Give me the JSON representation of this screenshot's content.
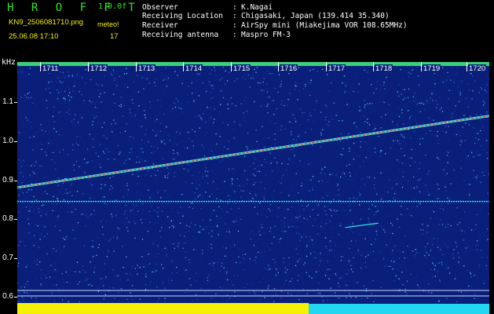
{
  "header": {
    "title": "H R O F F T",
    "version": "1.0.0f",
    "filename": "KN9_2506081710.png",
    "mode": "meteo!",
    "datetime": "25.06.08 17:10",
    "count": "17",
    "info": [
      {
        "label": "Observer",
        "value": "K.Nagai"
      },
      {
        "label": "Receiving Location",
        "value": "Chigasaki, Japan (139.414 35.340)"
      },
      {
        "label": "Receiver",
        "value": "AirSpy mini (Miakejima VOR 108.65MHz)"
      },
      {
        "label": "Receiving antenna",
        "value": "Maspro FM-3"
      }
    ],
    "colon": ":"
  },
  "axes": {
    "unit": "kHz",
    "y_ticks": [
      "1.1",
      "1.0",
      "0.9",
      "0.8",
      "0.7",
      "0.6"
    ],
    "x_ticks": [
      "1711",
      "1712",
      "1713",
      "1714",
      "1715",
      "1716",
      "1717",
      "1718",
      "1719",
      "1720"
    ]
  },
  "colors": {
    "background": "#0a1f7a",
    "signal_strong": "#ff2a2a",
    "signal_mid": "#2ee8e8",
    "bottom_bar_left": "#f4f000",
    "bottom_bar_right": "#22d8f0",
    "header_green": "#2ee82e",
    "header_yellow": "#f4f000"
  },
  "spectrogram": {
    "y_range_khz": [
      0.58,
      1.16
    ],
    "x_range_min": [
      1710.55,
      1720.55
    ],
    "traces": [
      {
        "name": "",
        "start": {
          "t": 1710.55,
          "f": 0.9
        },
        "end": {
          "t": 1720.55,
          "f": 1.065
        },
        "kind": "diagonal"
      },
      {
        "name": "",
        "start": {
          "t": 1710.55,
          "f": 0.868
        },
        "end": {
          "t": 1720.55,
          "f": 0.868
        },
        "kind": "horizontal"
      },
      {
        "name": "",
        "start": {
          "t": 1717.5,
          "f": 0.808
        },
        "end": {
          "t": 1718.2,
          "f": 0.818
        },
        "kind": "short"
      }
    ],
    "reference_lines_khz": [
      0.621,
      0.607
    ]
  }
}
